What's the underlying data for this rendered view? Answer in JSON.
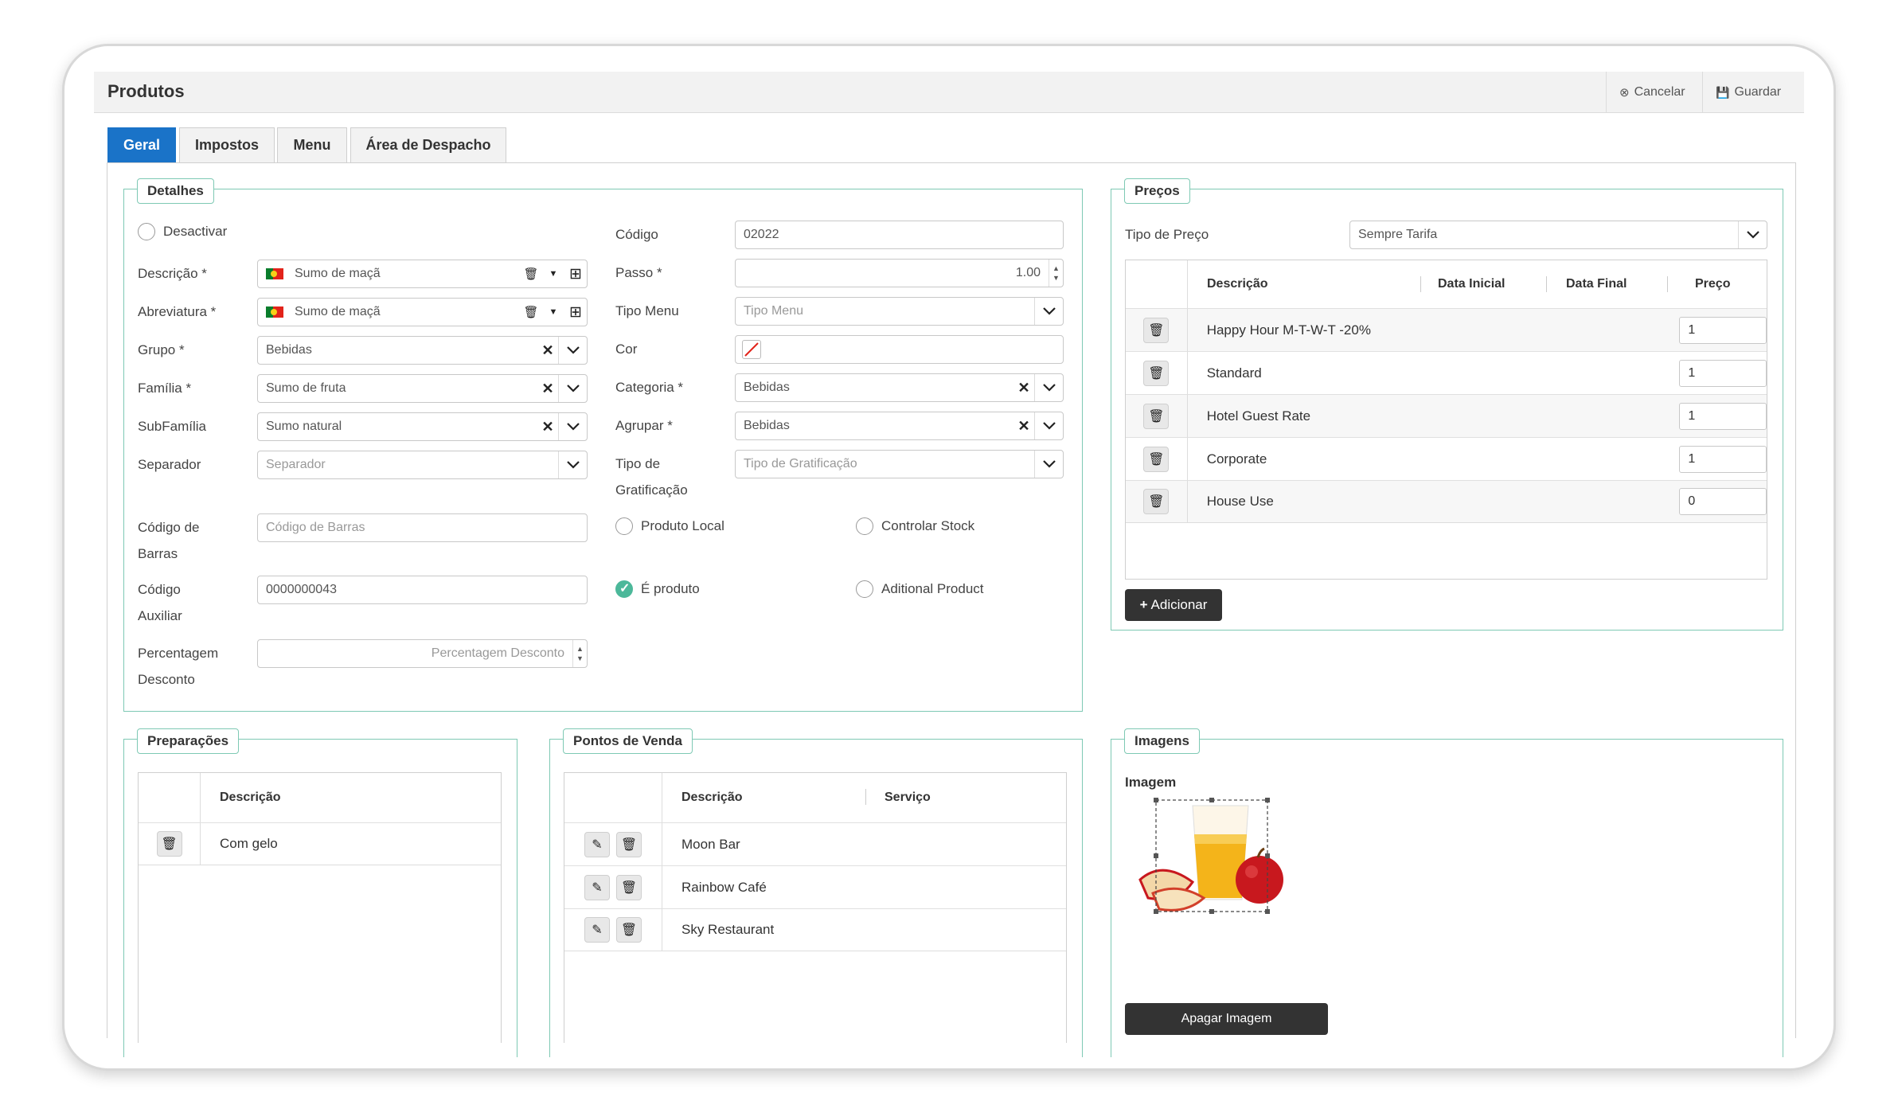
{
  "header": {
    "title": "Produtos",
    "cancel_label": "Cancelar",
    "save_label": "Guardar"
  },
  "tabs": [
    {
      "label": "Geral",
      "active": true
    },
    {
      "label": "Impostos"
    },
    {
      "label": "Menu"
    },
    {
      "label": "Área de Despacho"
    }
  ],
  "details": {
    "legend": "Detalhes",
    "deactivate_label": "Desactivar",
    "description_label": "Descrição *",
    "description_value": "Sumo de maçã",
    "abbreviation_label": "Abreviatura *",
    "abbreviation_value": "Sumo de maçã",
    "group_label": "Grupo *",
    "group_value": "Bebidas",
    "family_label": "Família *",
    "family_value": "Sumo de fruta",
    "subfamily_label": "SubFamília",
    "subfamily_value": "Sumo natural",
    "separator_label": "Separador",
    "separator_placeholder": "Separador",
    "barcode_label": "Código de Barras",
    "barcode_placeholder": "Código de Barras",
    "aux_code_label": "Código Auxiliar",
    "aux_code_value": "0000000043",
    "discount_label": "Percentagem Desconto",
    "discount_placeholder": "Percentagem Desconto",
    "code_label": "Código",
    "code_value": "02022",
    "step_label": "Passo *",
    "step_value": "1.00",
    "menu_type_label": "Tipo Menu",
    "menu_type_placeholder": "Tipo Menu",
    "color_label": "Cor",
    "category_label": "Categoria *",
    "category_value": "Bebidas",
    "group_by_label": "Agrupar *",
    "group_by_value": "Bebidas",
    "tip_type_label": "Tipo de Gratificação",
    "tip_type_placeholder": "Tipo de Gratificação",
    "local_product_label": "Produto Local",
    "control_stock_label": "Controlar Stock",
    "is_product_label": "É produto",
    "additional_product_label": "Aditional Product"
  },
  "prices": {
    "legend": "Preços",
    "price_type_label": "Tipo de Preço",
    "price_type_value": "Sempre Tarifa",
    "columns": [
      "Descrição",
      "Data Inicial",
      "Data Final",
      "Preço"
    ],
    "rows": [
      {
        "description": "Happy Hour M-T-W-T -20%",
        "price": "1"
      },
      {
        "description": "Standard",
        "price": "1"
      },
      {
        "description": "Hotel Guest Rate",
        "price": "1"
      },
      {
        "description": "Corporate",
        "price": "1"
      },
      {
        "description": "House Use",
        "price": "0"
      }
    ],
    "add_label": "Adicionar"
  },
  "preparations": {
    "legend": "Preparações",
    "column": "Descrição",
    "rows": [
      "Com gelo"
    ]
  },
  "points_of_sale": {
    "legend": "Pontos de Venda",
    "columns": [
      "Descrição",
      "Serviço"
    ],
    "rows": [
      "Moon Bar",
      "Rainbow Café",
      "Sky Restaurant"
    ]
  },
  "images": {
    "legend": "Imagens",
    "image_label": "Imagem",
    "delete_label": "Apagar Imagem"
  },
  "colors": {
    "accent": "#1a73c8",
    "panel_border": "#7ec9b4",
    "dark_button": "#333333",
    "check_on": "#4cb89a"
  }
}
